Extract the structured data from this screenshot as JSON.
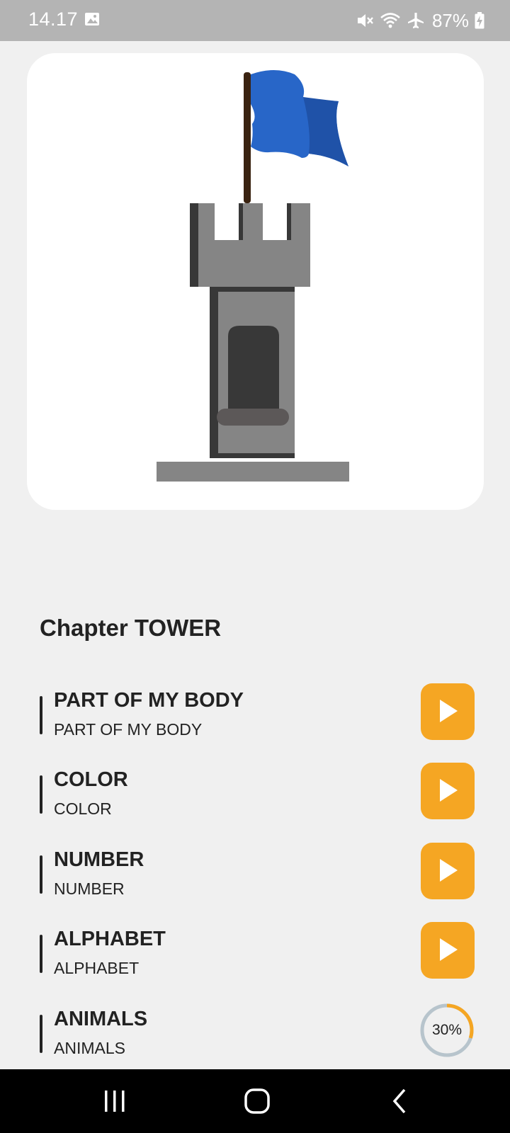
{
  "status_bar": {
    "time": "14.17",
    "battery": "87%",
    "icons": [
      "gallery-icon",
      "mute-icon",
      "wifi-icon",
      "airplane-mode-icon",
      "battery-charging-icon"
    ]
  },
  "hero": {
    "image": "tower-with-blue-flag"
  },
  "chapter": {
    "title": "Chapter TOWER"
  },
  "lessons": [
    {
      "title": "PART OF MY BODY",
      "subtitle": "PART OF MY BODY",
      "action": "play"
    },
    {
      "title": "COLOR",
      "subtitle": "COLOR",
      "action": "play"
    },
    {
      "title": "NUMBER",
      "subtitle": "NUMBER",
      "action": "play"
    },
    {
      "title": "ALPHABET",
      "subtitle": "ALPHABET",
      "action": "play"
    },
    {
      "title": "ANIMALS",
      "subtitle": "ANIMALS",
      "action": "progress",
      "progress_label": "30%",
      "progress": 0.3
    }
  ],
  "colors": {
    "accent": "#f5a623",
    "ring_track": "#b7c4cc",
    "flag": "#2866c8"
  },
  "nav_bar": {
    "icons": [
      "recent-apps-icon",
      "home-icon",
      "back-icon"
    ]
  }
}
